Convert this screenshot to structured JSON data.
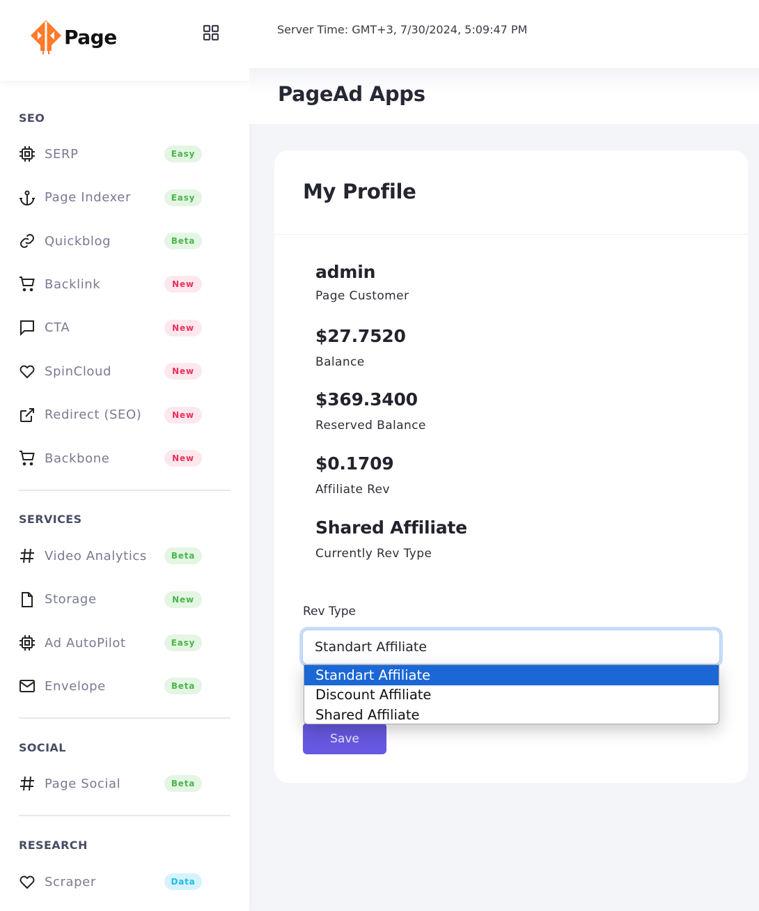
{
  "brand": {
    "name": "Page",
    "accent": "#ff7a2a"
  },
  "header": {
    "server_time": "Server Time: GMT+3, 7/30/2024, 5:09:47 PM",
    "page_title": "PageAd Apps"
  },
  "sidebar": {
    "sections": [
      {
        "title": "SEO",
        "items": [
          {
            "label": "SERP",
            "icon": "cpu-icon",
            "badge": "Easy",
            "badge_type": "green"
          },
          {
            "label": "Page Indexer",
            "icon": "anchor-icon",
            "badge": "Easy",
            "badge_type": "green"
          },
          {
            "label": "Quickblog",
            "icon": "link-icon",
            "badge": "Beta",
            "badge_type": "green"
          },
          {
            "label": "Backlink",
            "icon": "cart-icon",
            "badge": "New",
            "badge_type": "red"
          },
          {
            "label": "CTA",
            "icon": "message-icon",
            "badge": "New",
            "badge_type": "red"
          },
          {
            "label": "SpinCloud",
            "icon": "heart-icon",
            "badge": "New",
            "badge_type": "red"
          },
          {
            "label": "Redirect (SEO)",
            "icon": "external-link-icon",
            "badge": "New",
            "badge_type": "red"
          },
          {
            "label": "Backbone",
            "icon": "cart-icon",
            "badge": "New",
            "badge_type": "red"
          }
        ]
      },
      {
        "title": "SERVICES",
        "items": [
          {
            "label": "Video Analytics",
            "icon": "hash-icon",
            "badge": "Beta",
            "badge_type": "green"
          },
          {
            "label": "Storage",
            "icon": "file-icon",
            "badge": "New",
            "badge_type": "green"
          },
          {
            "label": "Ad AutoPilot",
            "icon": "cpu-icon",
            "badge": "Easy",
            "badge_type": "green"
          },
          {
            "label": "Envelope",
            "icon": "mail-icon",
            "badge": "Beta",
            "badge_type": "green"
          }
        ]
      },
      {
        "title": "SOCIAL",
        "items": [
          {
            "label": "Page Social",
            "icon": "hash-icon",
            "badge": "Beta",
            "badge_type": "green"
          }
        ]
      },
      {
        "title": "RESEARCH",
        "items": [
          {
            "label": "Scraper",
            "icon": "heart-icon",
            "badge": "Data",
            "badge_type": "blue"
          }
        ]
      }
    ]
  },
  "profile": {
    "title": "My Profile",
    "username": "admin",
    "role": "Page Customer",
    "stats": [
      {
        "value": "$27.7520",
        "label": "Balance"
      },
      {
        "value": "$369.3400",
        "label": "Reserved Balance"
      },
      {
        "value": "$0.1709",
        "label": "Affiliate Rev"
      },
      {
        "value": "Shared Affiliate",
        "label": "Currently Rev Type"
      }
    ],
    "rev_type": {
      "label": "Rev Type",
      "selected": "Standart Affiliate",
      "options": [
        "Standart Affiliate",
        "Discount Affiliate",
        "Shared Affiliate"
      ],
      "highlighted_index": 0
    },
    "save_label": "Save"
  }
}
